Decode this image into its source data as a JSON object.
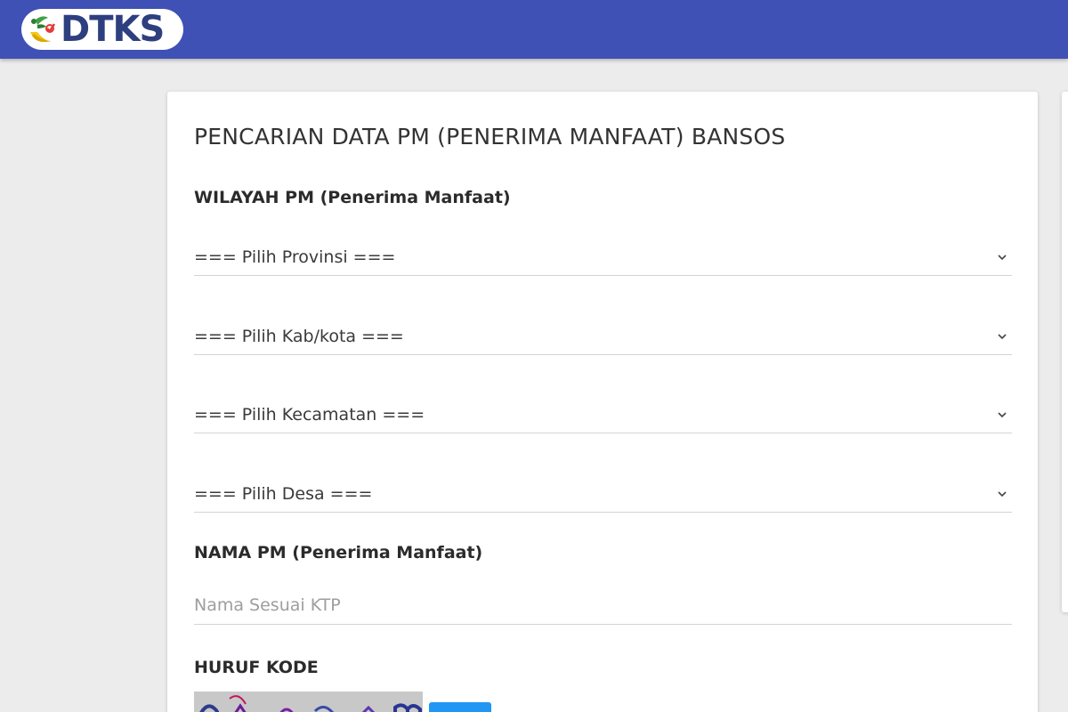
{
  "header": {
    "logo_text": "DTKS",
    "colors": {
      "bar": "#3f51b5",
      "logo_text": "#2e3f80"
    }
  },
  "form": {
    "title": "PENCARIAN DATA PM (PENERIMA MANFAAT) BANSOS",
    "wilayah_label": "WILAYAH PM (Penerima Manfaat)",
    "provinsi_select": "=== Pilih Provinsi ===",
    "kabkota_select": "=== Pilih Kab/kota ===",
    "kecamatan_select": "=== Pilih Kecamatan ===",
    "desa_select": "=== Pilih Desa ===",
    "nama_label": "NAMA PM (Penerima Manfaat)",
    "nama_placeholder": "Nama Sesuai KTP",
    "kode_label": "HURUF KODE"
  },
  "icons": {
    "select_arrow": "chevron-down-icon",
    "logo_mark": "dtks-logo-icon"
  }
}
